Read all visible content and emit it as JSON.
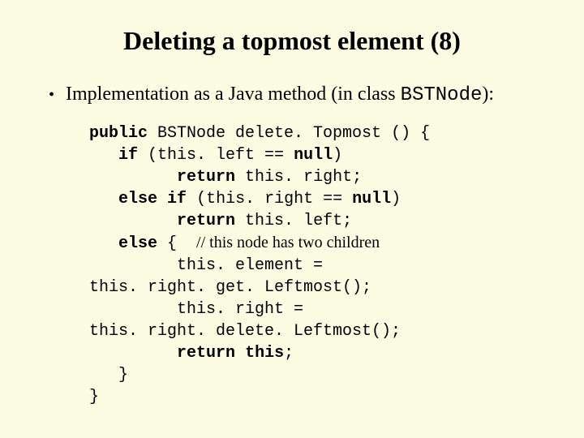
{
  "title": "Deleting a topmost element (8)",
  "bullet": {
    "prefix": "Implementation as a Java method (in class ",
    "classname": "BSTNode",
    "suffix": "):"
  },
  "code": {
    "kw_public": "public",
    "t_sig": " BSTNode delete. Topmost () {",
    "kw_if": "if",
    "t_if_cond1": " (this. left == ",
    "kw_null1": "null",
    "t_if_cond1b": ")",
    "kw_return1": "return",
    "t_ret1": " this. right;",
    "kw_else1": "else",
    "t_sp1": " ",
    "kw_if2": "if",
    "t_if_cond2": " (this. right == ",
    "kw_null2": "null",
    "t_if_cond2b": ")",
    "kw_return2": "return",
    "t_ret2": " this. left;",
    "kw_else2": "else",
    "t_brace": " {  ",
    "comment": "// this node has two children",
    "t_assign1": "this. element =",
    "t_assign1b": "this. right. get. Leftmost();",
    "t_assign2": "this. right =",
    "t_assign2b": "this. right. delete. Leftmost();",
    "kw_return3": "return",
    "t_ret3": " ",
    "kw_this": "this",
    "t_semi": ";",
    "t_close1": "}",
    "t_close2": "}"
  }
}
